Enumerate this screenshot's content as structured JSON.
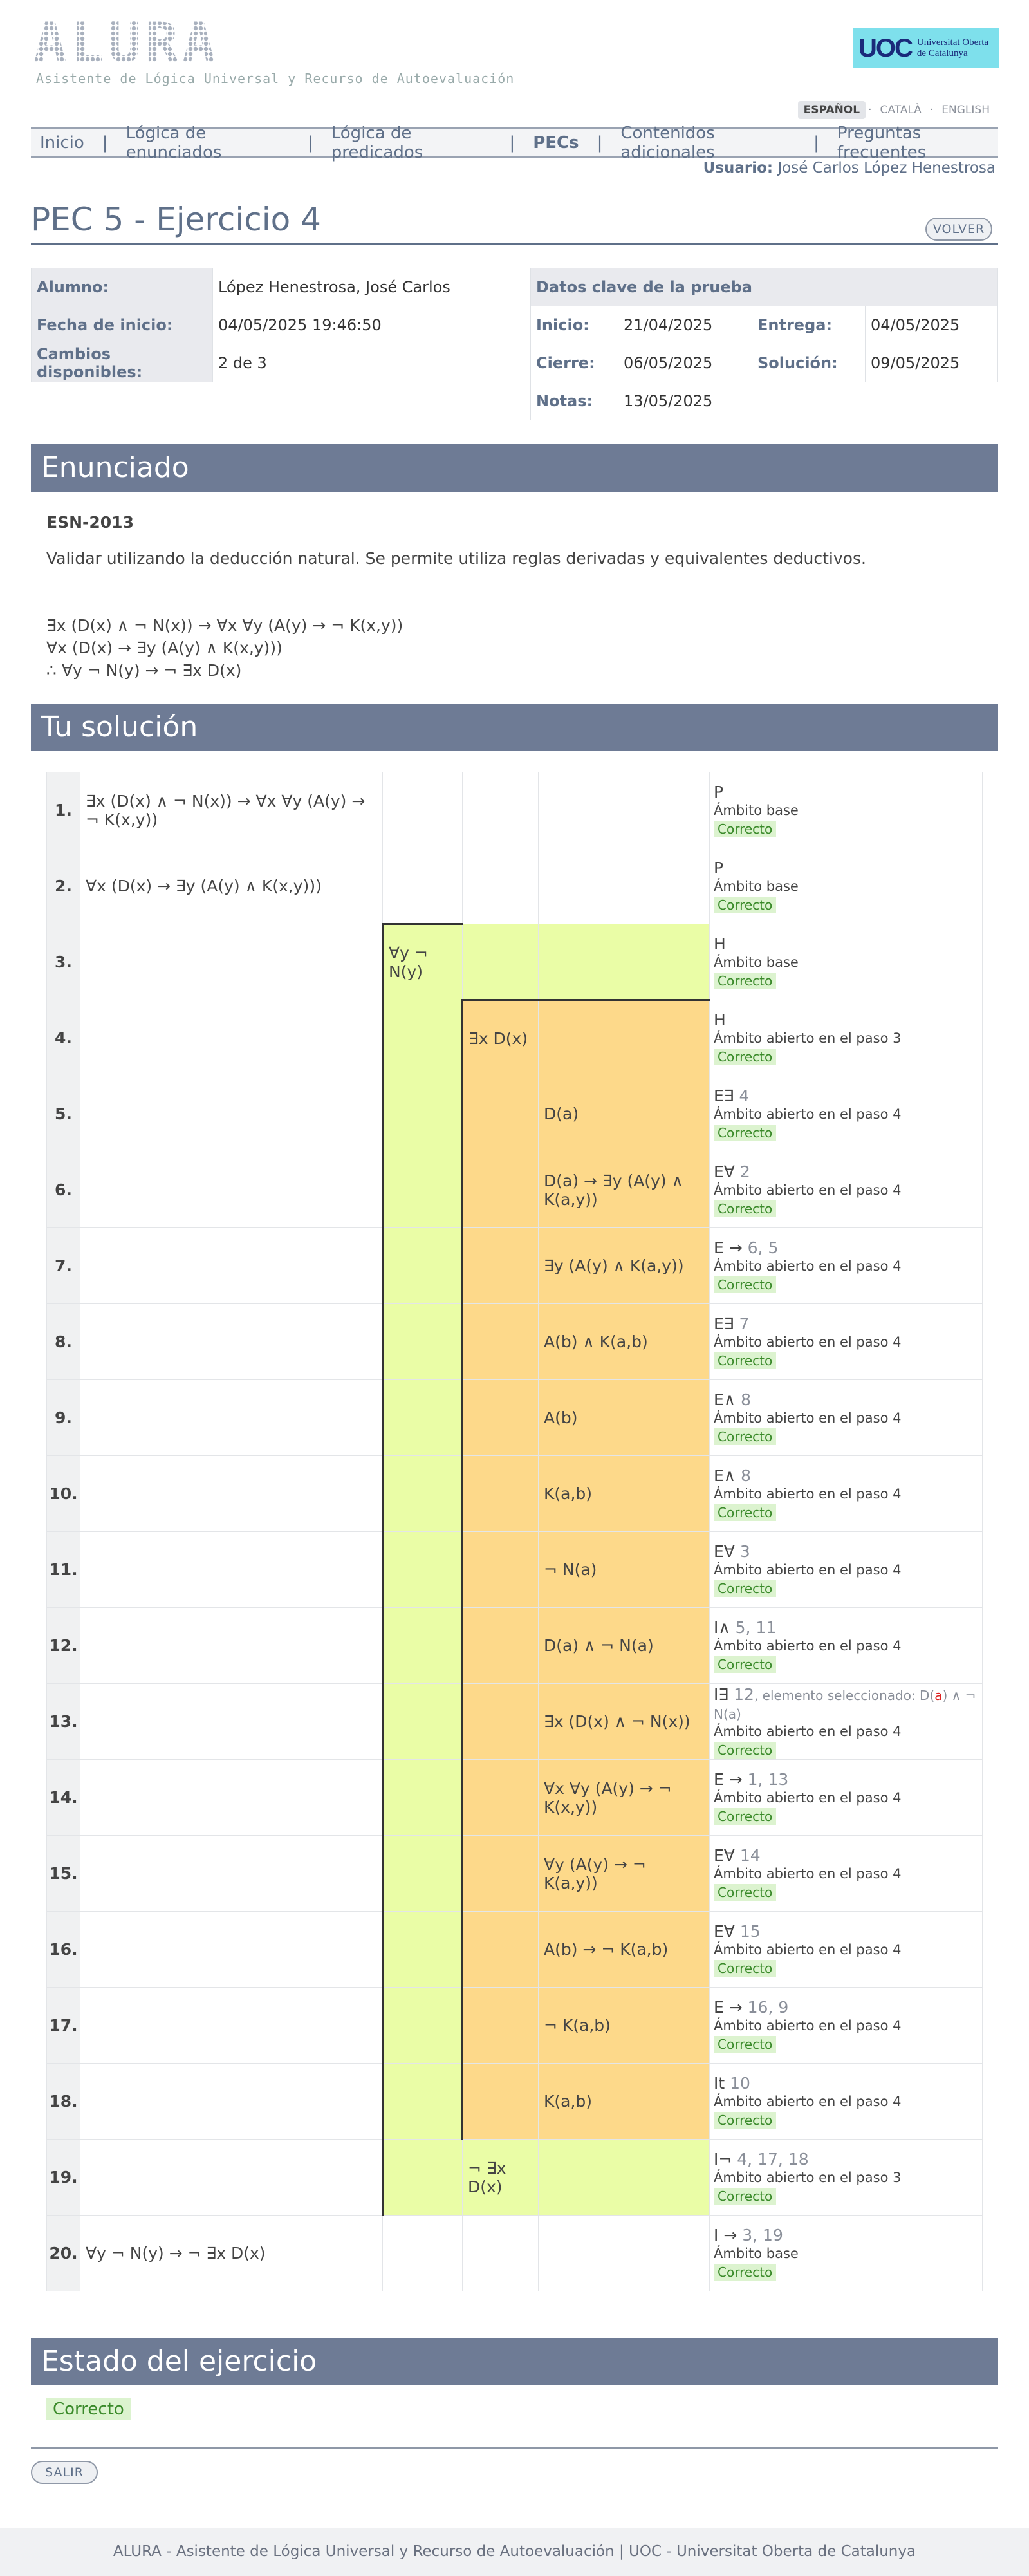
{
  "header": {
    "logo_text": "ALURA",
    "subtitle": "Asistente de Lógica Universal y Recurso de Autoevaluación",
    "uoc_mark": "UOC",
    "uoc_name_1": "Universitat Oberta",
    "uoc_name_2": "de Catalunya",
    "languages": [
      "ESPAÑOL",
      "CATALÀ",
      "ENGLISH"
    ]
  },
  "nav": {
    "items": [
      "Inicio",
      "Lógica de enunciados",
      "Lógica de predicados",
      "PECs",
      "Contenidos adicionales",
      "Preguntas frecuentes"
    ],
    "active": "PECs"
  },
  "user": {
    "label": "Usuario:",
    "name": "José Carlos López Henestrosa"
  },
  "page": {
    "title": "PEC 5 - Ejercicio 4",
    "back_button": "VOLVER",
    "exit_button": "SALIR"
  },
  "student": {
    "alumno_label": "Alumno:",
    "alumno": "López Henestrosa, José Carlos",
    "fecha_label": "Fecha de inicio:",
    "fecha": "04/05/2025 19:46:50",
    "cambios_label": "Cambios disponibles:",
    "cambios": "2 de 3"
  },
  "test": {
    "header": "Datos clave de la prueba",
    "inicio_label": "Inicio:",
    "inicio": "21/04/2025",
    "entrega_label": "Entrega:",
    "entrega": "04/05/2025",
    "cierre_label": "Cierre:",
    "cierre": "06/05/2025",
    "solucion_label": "Solución:",
    "solucion": "09/05/2025",
    "notas_label": "Notas:",
    "notas": "13/05/2025"
  },
  "enunciado": {
    "heading": "Enunciado",
    "code": "ESN-2013",
    "text": "Validar utilizando la deducción natural. Se permite utiliza reglas derivadas y equivalentes deductivos.",
    "premises": [
      "∃x (D(x) ∧ ¬ N(x)) → ∀x ∀y (A(y) → ¬ K(x,y))",
      "∀x (D(x) → ∃y (A(y) ∧ K(x,y)))",
      "∴ ∀y ¬ N(y) → ¬ ∃x D(x)"
    ]
  },
  "solution": {
    "heading": "Tu solución",
    "rows": [
      {
        "n": "1.",
        "f": "∃x (D(x) ∧ ¬ N(x)) → ∀x ∀y (A(y) → ¬ K(x,y))",
        "rule": "P",
        "nums": "",
        "scope": "Ámbito base",
        "status": "Correcto"
      },
      {
        "n": "2.",
        "f": "∀x (D(x) → ∃y (A(y) ∧ K(x,y)))",
        "rule": "P",
        "nums": "",
        "scope": "Ámbito base",
        "status": "Correcto"
      },
      {
        "n": "3.",
        "f": "∀y ¬ N(y)",
        "rule": "H",
        "nums": "",
        "scope": "Ámbito base",
        "status": "Correcto"
      },
      {
        "n": "4.",
        "f": "∃x D(x)",
        "rule": "H",
        "nums": "",
        "scope": "Ámbito abierto en el paso 3",
        "status": "Correcto"
      },
      {
        "n": "5.",
        "f": "D(a)",
        "rule": "E∃",
        "nums": "4",
        "scope": "Ámbito abierto en el paso 4",
        "status": "Correcto"
      },
      {
        "n": "6.",
        "f": "D(a) → ∃y (A(y) ∧ K(a,y))",
        "rule": "E∀",
        "nums": "2",
        "scope": "Ámbito abierto en el paso 4",
        "status": "Correcto"
      },
      {
        "n": "7.",
        "f": "∃y (A(y) ∧ K(a,y))",
        "rule": "E →",
        "nums": "6, 5",
        "scope": "Ámbito abierto en el paso 4",
        "status": "Correcto"
      },
      {
        "n": "8.",
        "f": "A(b) ∧ K(a,b)",
        "rule": "E∃",
        "nums": "7",
        "scope": "Ámbito abierto en el paso 4",
        "status": "Correcto"
      },
      {
        "n": "9.",
        "f": "A(b)",
        "rule": "E∧",
        "nums": "8",
        "scope": "Ámbito abierto en el paso 4",
        "status": "Correcto"
      },
      {
        "n": "10.",
        "f": "K(a,b)",
        "rule": "E∧",
        "nums": "8",
        "scope": "Ámbito abierto en el paso 4",
        "status": "Correcto"
      },
      {
        "n": "11.",
        "f": "¬ N(a)",
        "rule": "E∀",
        "nums": "3",
        "scope": "Ámbito abierto en el paso 4",
        "status": "Correcto"
      },
      {
        "n": "12.",
        "f": "D(a) ∧ ¬ N(a)",
        "rule": "I∧",
        "nums": "5, 11",
        "scope": "Ámbito abierto en el paso 4",
        "status": "Correcto"
      },
      {
        "n": "13.",
        "f": "∃x (D(x) ∧ ¬ N(x))",
        "rule": "I∃",
        "nums": "12",
        "sel_label": ", elemento seleccionado: D(",
        "sel_a": "a",
        "sel_rest": ") ∧ ¬ N(a)",
        "scope": "Ámbito abierto en el paso 4",
        "status": "Correcto"
      },
      {
        "n": "14.",
        "f": "∀x ∀y (A(y) → ¬ K(x,y))",
        "rule": "E →",
        "nums": "1, 13",
        "scope": "Ámbito abierto en el paso 4",
        "status": "Correcto"
      },
      {
        "n": "15.",
        "f": "∀y (A(y) → ¬ K(a,y))",
        "rule": "E∀",
        "nums": "14",
        "scope": "Ámbito abierto en el paso 4",
        "status": "Correcto"
      },
      {
        "n": "16.",
        "f": "A(b) → ¬ K(a,b)",
        "rule": "E∀",
        "nums": "15",
        "scope": "Ámbito abierto en el paso 4",
        "status": "Correcto"
      },
      {
        "n": "17.",
        "f": "¬ K(a,b)",
        "rule": "E →",
        "nums": "16, 9",
        "scope": "Ámbito abierto en el paso 4",
        "status": "Correcto"
      },
      {
        "n": "18.",
        "f": "K(a,b)",
        "rule": "It",
        "nums": "10",
        "scope": "Ámbito abierto en el paso 4",
        "status": "Correcto"
      },
      {
        "n": "19.",
        "f": "¬ ∃x D(x)",
        "rule": "I¬",
        "nums": "4, 17, 18",
        "scope": "Ámbito abierto en el paso 3",
        "status": "Correcto"
      },
      {
        "n": "20.",
        "f": "∀y ¬ N(y) → ¬ ∃x D(x)",
        "rule": "I →",
        "nums": "3, 19",
        "scope": "Ámbito base",
        "status": "Correcto"
      }
    ]
  },
  "estado": {
    "heading": "Estado del ejercicio",
    "value": "Correcto"
  },
  "footer": "ALURA - Asistente de Lógica Universal y Recurso de Autoevaluación | UOC - Universitat Oberta de Catalunya",
  "colors": {
    "nav_text": "#5f7089",
    "section_bar": "#6e7b95",
    "scope_green": "#eafda6",
    "scope_orange": "#fdd98a",
    "ok_bg": "#dcf3cf"
  }
}
